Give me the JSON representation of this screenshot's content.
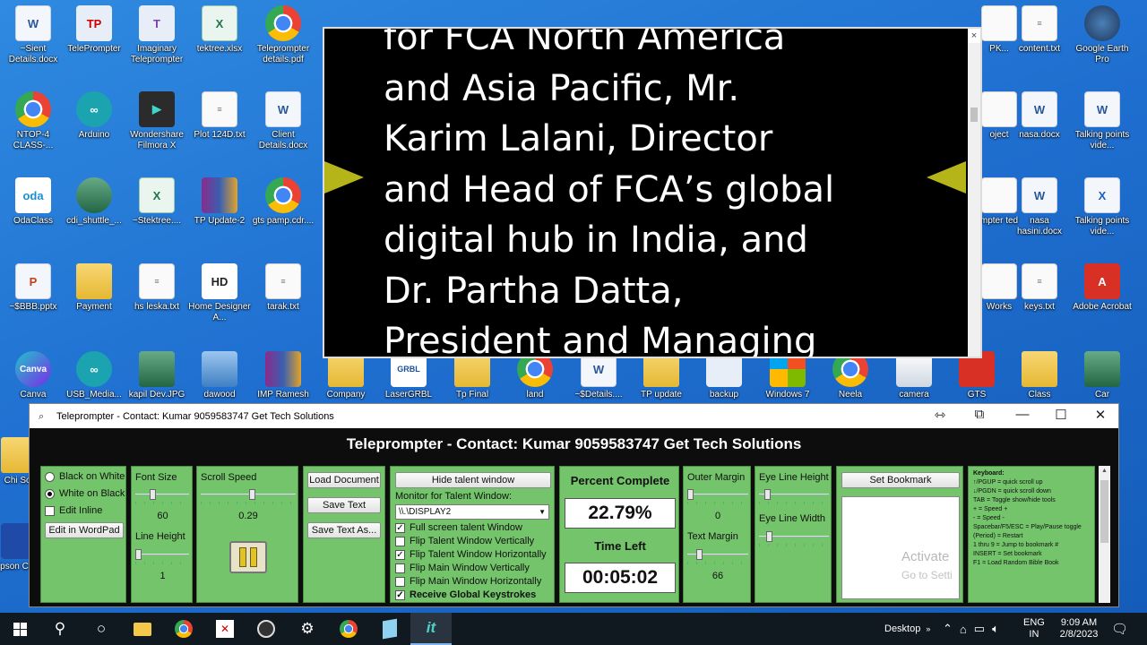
{
  "desktop": {
    "icons": [
      {
        "label": "~Sient Details.docx",
        "icon": "word-doc-icon"
      },
      {
        "label": "TelePrompter",
        "icon": "teleprompter-app-icon"
      },
      {
        "label": "Imaginary Teleprompter",
        "icon": "imaginary-teleprompter-icon"
      },
      {
        "label": "tektree.xlsx",
        "icon": "excel-icon"
      },
      {
        "label": "Teleprompter details.pdf",
        "icon": "chrome-icon"
      },
      {
        "label": "PK...",
        "icon": "file-icon"
      },
      {
        "label": "content.txt",
        "icon": "text-file-icon"
      },
      {
        "label": "Google Earth Pro",
        "icon": "google-earth-icon"
      },
      {
        "label": "NTOP-4 CLASS-...",
        "icon": "chrome-icon"
      },
      {
        "label": "Arduino",
        "icon": "arduino-icon"
      },
      {
        "label": "Wondershare Filmora X",
        "icon": "filmora-icon"
      },
      {
        "label": "Plot 124D.txt",
        "icon": "text-file-icon"
      },
      {
        "label": "Client Details.docx",
        "icon": "word-doc-icon"
      },
      {
        "label": "oject",
        "icon": "file-icon"
      },
      {
        "label": "nasa.docx",
        "icon": "word-doc-icon"
      },
      {
        "label": "Talking points vide...",
        "icon": "word-doc-icon"
      },
      {
        "label": "OdaClass",
        "icon": "oda-icon"
      },
      {
        "label": "cdi_shuttle_...",
        "icon": "shuttle-image-icon"
      },
      {
        "label": "~Stektree....",
        "icon": "excel-icon"
      },
      {
        "label": "TP Update-2",
        "icon": "rar-icon"
      },
      {
        "label": "gts pamp.cdr....",
        "icon": "chrome-icon"
      },
      {
        "label": "mpter ted",
        "icon": "file-icon"
      },
      {
        "label": "nasa hasini.docx",
        "icon": "word-doc-icon"
      },
      {
        "label": "Talking points vide...",
        "icon": "xaml-icon"
      },
      {
        "label": "~$BBB.pptx",
        "icon": "pptx-icon"
      },
      {
        "label": "Payment",
        "icon": "folder-icon"
      },
      {
        "label": "hs leska.txt",
        "icon": "text-file-icon"
      },
      {
        "label": "Home Designer A...",
        "icon": "home-designer-icon"
      },
      {
        "label": "tarak.txt",
        "icon": "text-file-icon"
      },
      {
        "label": "Works",
        "icon": "file-icon"
      },
      {
        "label": "keys.txt",
        "icon": "text-file-icon"
      },
      {
        "label": "Adobe Acrobat",
        "icon": "acrobat-icon"
      },
      {
        "label": "Canva",
        "icon": "canva-icon"
      },
      {
        "label": "USB_Media...",
        "icon": "arduino-icon"
      },
      {
        "label": "kapil Dev.JPG",
        "icon": "photo-icon"
      },
      {
        "label": "dawood",
        "icon": "monitor-icon"
      },
      {
        "label": "IMP Ramesh",
        "icon": "rar-icon"
      },
      {
        "label": "Company",
        "icon": "folder-icon"
      },
      {
        "label": "LaserGRBL",
        "icon": "lasergrbl-icon"
      },
      {
        "label": "Tp Final",
        "icon": "folder-icon"
      },
      {
        "label": "land",
        "icon": "chrome-icon"
      },
      {
        "label": "~$Details....",
        "icon": "word-doc-icon"
      },
      {
        "label": "TP update",
        "icon": "folder-icon"
      },
      {
        "label": "backup",
        "icon": "drive-icon"
      },
      {
        "label": "Windows 7",
        "icon": "windows-shield-icon"
      },
      {
        "label": "Neela",
        "icon": "chrome-icon"
      },
      {
        "label": "camera",
        "icon": "monitor-icon"
      },
      {
        "label": "GTS",
        "icon": "pdf-icon"
      },
      {
        "label": "Class",
        "icon": "folder-icon"
      },
      {
        "label": "Car",
        "icon": "car-image-icon"
      },
      {
        "label": "Chi Sof",
        "icon": "file-icon"
      },
      {
        "label": "Epson Conn",
        "icon": "epson-icon"
      }
    ]
  },
  "talent_window": {
    "lines": [
      "for FCA North America",
      "and Asia Pacific, Mr.",
      "Karim Lalani, Director",
      "and Head of FCA’s global",
      "digital hub in India, and",
      "Dr. Partha Datta,",
      "President and Managing"
    ],
    "close_glyph": "×"
  },
  "main_window": {
    "title": "Teleprompter - Contact: Kumar 9059583747  Get Tech Solutions",
    "header": "Teleprompter - Contact: Kumar 9059583747  Get Tech Solutions",
    "colors": {
      "panel_green": "#73c46a",
      "window_bg": "#0d0d0d"
    },
    "display_mode": {
      "options": [
        "Black on White",
        "White on Black"
      ],
      "selected": "White on Black",
      "edit_inline": "Edit Inline",
      "edit_wordpad": "Edit in WordPad"
    },
    "font_size": {
      "label": "Font Size",
      "value": "60",
      "level": 0.3
    },
    "line_height": {
      "label": "Line Height",
      "value": "1",
      "level": 0.0
    },
    "scroll_speed": {
      "label": "Scroll Speed",
      "value": "0.29",
      "level": 0.55,
      "pause_icon": "pause-icon"
    },
    "file_buttons": {
      "load": "Load Document",
      "save": "Save Text",
      "save_as": "Save Text As..."
    },
    "talent": {
      "hide_button": "Hide talent window",
      "monitor_label": "Monitor for Talent Window:",
      "monitor_value": "\\\\.\\DISPLAY2",
      "options": [
        {
          "label": "Full screen talent Window",
          "checked": true
        },
        {
          "label": "Flip Talent Window Vertically",
          "checked": false
        },
        {
          "label": "Flip Talent Window Horizontally",
          "checked": true
        },
        {
          "label": "Flip Main Window Vertically",
          "checked": false
        },
        {
          "label": "Flip Main Window Horizontally",
          "checked": false
        },
        {
          "label": "Receive Global Keystrokes",
          "checked": true
        }
      ]
    },
    "progress": {
      "percent_label": "Percent Complete",
      "percent_value": "22.79%",
      "time_label": "Time Left",
      "time_value": "00:05:02"
    },
    "margins": {
      "outer_label": "Outer Margin",
      "outer_value": "0",
      "text_label": "Text Margin",
      "text_value": "66"
    },
    "eye_line": {
      "height_label": "Eye Line Height",
      "width_label": "Eye Line Width"
    },
    "bookmark": {
      "button": "Set Bookmark",
      "watermark_1": "Activate",
      "watermark_2": "Go to Setti"
    },
    "keyboard_help": [
      "Keyboard:",
      "↑/PGUP = quick scroll up",
      "↓/PGDN = quick scroll down",
      "TAB = Toggle show/hide tools",
      "+ = Speed +",
      "- = Speed -",
      "Spacebar/F5/ESC = Play/Pause toggle",
      "(Period) = Restart",
      "1 thru 9 = Jump to bookmark #",
      "INSERT = Set bookmark",
      "F1 = Load Random Bible Book"
    ]
  },
  "taskbar": {
    "desktop_label": "Desktop",
    "lang_1": "ENG",
    "lang_2": "IN",
    "time": "9:09 AM",
    "date": "2/8/2023"
  }
}
